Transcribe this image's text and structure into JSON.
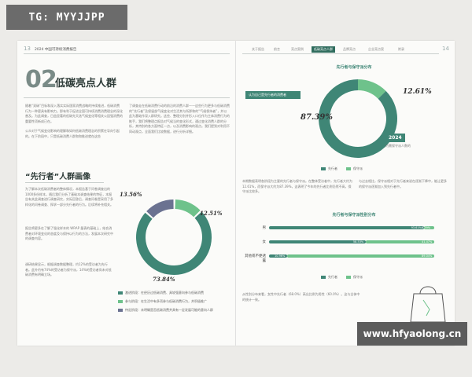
{
  "overlay": {
    "tg": "TG: MYYJJPP",
    "watermark": "www.hfyaolong.cn"
  },
  "left": {
    "page_no": "13",
    "header_title": "2024 中国可持续消费报告",
    "big_no": "02",
    "section_title": "低碳亮点人群",
    "para1": "随着“双碳”目标和深入落实实际国家消费战略的持续推进，低碳消费行为一种更具有影响力。那有利于促进全国可持续消费消费理念的深化普及。为此调查，日益显著的低碳先天选气候变化等相关公因强消费的重要性项新成已在。",
    "para2": "公众对于气候变化影响的理解和如何低碳消费理念的积累在导向引起的。在下阶段中，只是低碳消费人群和和推进就在这些",
    "para3": "了调查走在低碳消费行动的前沿的消费人群——这些行为更多与低碳消费的“先行者”及保留部气候变化对生活其与所那和的“气候保持者”，并以此为基础作深入群研究。这些、整理分别并形入口位作为主体消费行为的推手，我们将整理点报告对气候当的变化形式，通过变化消费人群的分析，其特别的各方面特征一点，以及消费影响的观点。我们提到对利用不同动观点，全面我们比较数据，进行分析详细。",
    "h2": "“先行者”人群画像",
    "para4": "为了解本次低碳消费者的整体情况，本报告基于问卷调查出的1000多份样本，随后我们分析了基础本调查结果的特征，本报告有关此调查进行调查研究，实际回答后，调查问卷是采用了多样化的问卷调查、探求一部分先行者的行为。后续将补充相关。",
    "para5": "报告将更多在了解了强化样本的 WRAP 量表的基础上，结合消费者对环境变化的态度及与保持以行为的方法，发展本次研究中的调查内容。",
    "para6": "调研结果显示，根据调查数据整理，约12%的受访者为先行者。此外约有74%的受访者为保守派，14%的受访者尚未对低碳消费有明确立场。",
    "legend_items": [
      "激进阶段：在经历过低碳消费、具较强意向参与低碳消费",
      "参与阶段：在生活中有多项参与低碳消费行为，并积极推广",
      "待定阶段：未明确是否低碳消费并具有一定发展可能的意向人群"
    ]
  },
  "right": {
    "page_no": "14",
    "nav_items": [
      "关于报告",
      "前言",
      "亮点案例",
      "低碳亮点人群",
      "品牌亮点",
      "企业亮点案",
      "附录"
    ],
    "nav_active_index": 3,
    "chart1_title": "先行者与保守派分布",
    "badge1": "认为自己是先行者的消费者",
    "badge2_year": "2024",
    "badge2_text": "仅有 7 % 的消费者认为自己是先行者",
    "badge2_suffix": "约需保守派人数的",
    "legend1": [
      "先行者",
      "保守派"
    ],
    "para1": "本期数据表明各阶段为主要的先行者与保守派。在整体受访者中，先行者大约为12.61%，而保守派大约为87.39%，这表明了今年的先行者比例仍然不高，保守派比较多。",
    "para2": "与过去相比，保守派相对于先行者来说在逐渐下降中，能让更多的保守派逐渐加入到先行者中。",
    "chart2_title": "先行者与保守派性别分布",
    "legend2": [
      "先行者",
      "保守派"
    ],
    "para3": "从性别分布来看，女性中先行者（68.0%）高出比例为男性（60.0%）。这与全体中的统计一致。"
  },
  "chart_data": [
    {
      "type": "pie",
      "title": "",
      "categories": [
        "",
        "",
        ""
      ],
      "values": [
        13.56,
        12.51,
        73.84
      ],
      "labels": [
        "13.56%",
        "12.51%",
        "73.84%"
      ],
      "colors": [
        "#6b7291",
        "#6ec28b",
        "#3f8676"
      ]
    },
    {
      "type": "pie",
      "title": "先行者与保守派分布",
      "categories": [
        "先行者",
        "保守派"
      ],
      "values": [
        12.61,
        87.39
      ],
      "labels": [
        "12.61%",
        "87.39%"
      ],
      "colors": [
        "#6ec28b",
        "#3f8676"
      ]
    },
    {
      "type": "bar",
      "title": "先行者与保守派性别分布",
      "categories": [
        "男",
        "女",
        "其他或不便透露"
      ],
      "series": [
        {
          "name": "先行者",
          "values": [
            93.61,
            58.53,
            10.96
          ],
          "labels": [
            "93.61%",
            "58.53%",
            "10.96%"
          ]
        },
        {
          "name": "保守派",
          "values": [
            6.39,
            41.47,
            89.04
          ],
          "labels": [
            "6.39%",
            "41.47%",
            "89.04%"
          ]
        }
      ],
      "colors": [
        "#3f8676",
        "#6ec28b"
      ]
    }
  ],
  "colors": {
    "accent": "#3f8676",
    "light": "#6ec28b",
    "muted": "#6b7291"
  }
}
